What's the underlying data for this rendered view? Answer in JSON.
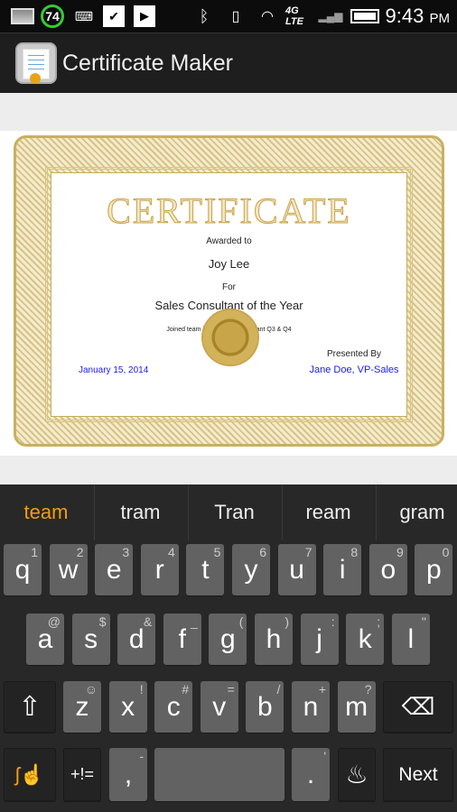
{
  "status_bar": {
    "battery_level_badge": "74",
    "time": "9:43",
    "ampm": "PM",
    "network": "4G LTE",
    "icons": [
      "gallery-icon",
      "battery-level-icon",
      "keyboard-icon",
      "task-check-icon",
      "play-store-icon",
      "bluetooth-icon",
      "vibrate-icon",
      "wifi-icon",
      "4g-lte-icon",
      "signal-icon",
      "battery-icon"
    ]
  },
  "action_bar": {
    "title": "Certificate Maker"
  },
  "certificate": {
    "title": "CERTIFICATE",
    "awarded_label": "Awarded to",
    "recipient": "Joy Lee",
    "for_label": "For",
    "award": "Sales Consultant of the Year",
    "description": "Joined team in May. Top consultant Q3 & Q4",
    "presented_label": "Presented By",
    "date": "January 15, 2014",
    "presenter": "Jane Doe, VP-Sales",
    "accent": "#c9a24a",
    "link_color": "#1a1aff"
  },
  "keyboard": {
    "suggestions": [
      "team",
      "tram",
      "Tran",
      "ream",
      "gram"
    ],
    "suggestion_highlight": "#f39c12",
    "row1": [
      [
        "q",
        "1"
      ],
      [
        "w",
        "2"
      ],
      [
        "e",
        "3"
      ],
      [
        "r",
        "4"
      ],
      [
        "t",
        "5"
      ],
      [
        "y",
        "6"
      ],
      [
        "u",
        "7"
      ],
      [
        "i",
        "8"
      ],
      [
        "o",
        "9"
      ],
      [
        "p",
        "0"
      ]
    ],
    "row2": [
      [
        "a",
        "@"
      ],
      [
        "s",
        "$"
      ],
      [
        "d",
        "&"
      ],
      [
        "f",
        "_"
      ],
      [
        "g",
        "("
      ],
      [
        "h",
        ")"
      ],
      [
        "j",
        ":"
      ],
      [
        "k",
        ";"
      ],
      [
        "l",
        "\""
      ]
    ],
    "row3": [
      [
        "z",
        "☺"
      ],
      [
        "x",
        "!"
      ],
      [
        "c",
        "#"
      ],
      [
        "v",
        "="
      ],
      [
        "b",
        "/"
      ],
      [
        "n",
        "+"
      ],
      [
        "m",
        "?"
      ]
    ],
    "symbols_label": "+!=",
    "comma": ",",
    "comma_alt": "-",
    "period": ".",
    "period_alt": "'",
    "next_label": "Next"
  }
}
